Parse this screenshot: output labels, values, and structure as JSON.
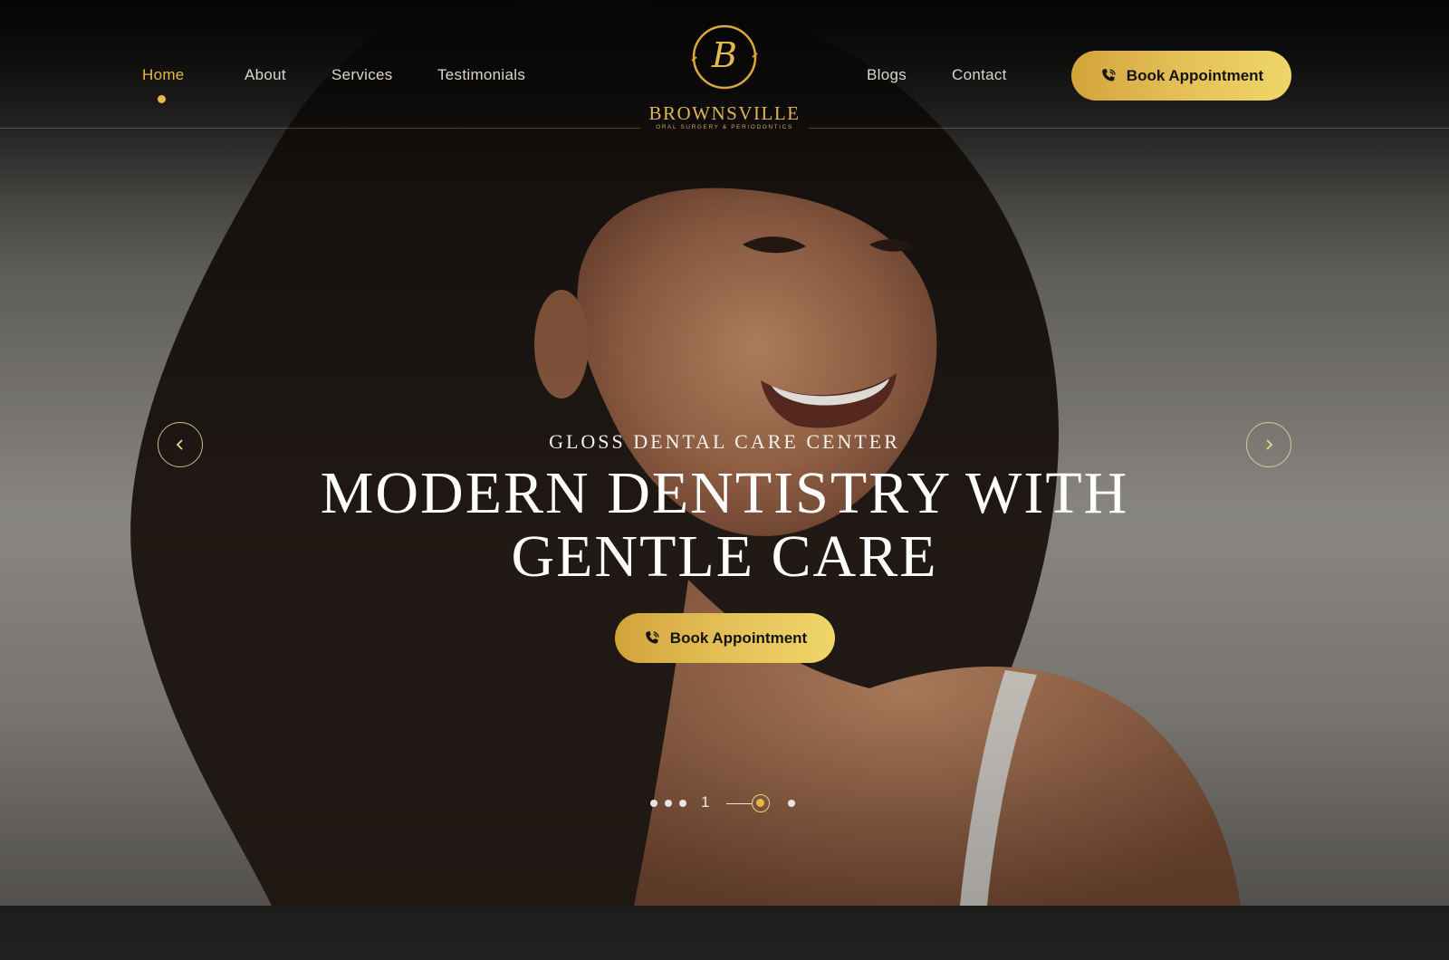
{
  "nav": {
    "links": [
      {
        "label": "Home",
        "active": true
      },
      {
        "label": "About"
      },
      {
        "label": "Services"
      },
      {
        "label": "Testimonials"
      },
      {
        "label": "Blogs"
      },
      {
        "label": "Contact"
      }
    ],
    "cta_label": "Book Appointment"
  },
  "logo": {
    "monogram": "B",
    "name": "BROWNSVILLE",
    "tagline": "ORAL SURGERY & PERIODONTICS"
  },
  "hero": {
    "eyebrow": "GLOSS DENTAL CARE CENTER",
    "headline_line1": "MODERN DENTISTRY WITH",
    "headline_line2": "GENTLE CARE",
    "cta_label": "Book Appointment",
    "prev_icon": "chevron-left-icon",
    "next_icon": "chevron-right-icon"
  },
  "pager": {
    "current_number": "1"
  },
  "colors": {
    "gold": "#e7b843",
    "gold_light": "#efd669",
    "dark": "#141414"
  }
}
